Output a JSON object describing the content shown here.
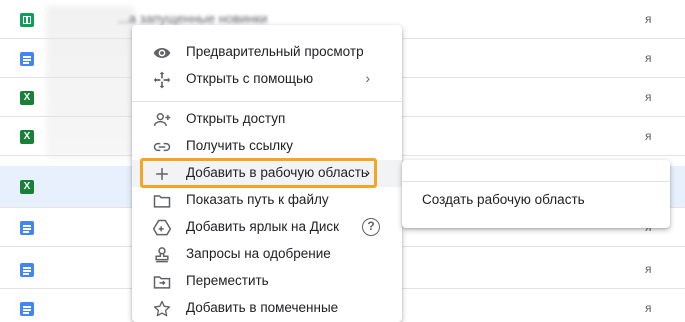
{
  "file_list": {
    "top_row_name": "...а запущенные новинки",
    "rows": [
      {
        "type": "sheet",
        "icon": "google-sheets-icon",
        "owner": "я"
      },
      {
        "type": "doc",
        "icon": "google-docs-icon",
        "owner": "я"
      },
      {
        "type": "excel",
        "icon": "excel-icon",
        "owner": "я"
      },
      {
        "type": "excel",
        "icon": "excel-icon",
        "owner": "я"
      },
      {
        "type": "excel",
        "icon": "excel-icon",
        "owner": "я",
        "selected": true
      },
      {
        "type": "doc",
        "icon": "google-docs-icon",
        "owner": "я"
      },
      {
        "type": "doc",
        "icon": "google-docs-icon",
        "owner": "я"
      },
      {
        "type": "doc",
        "icon": "google-docs-icon",
        "owner": "я"
      }
    ],
    "icon_letters": {
      "excel": "X"
    }
  },
  "context_menu": {
    "items": [
      {
        "label": "Предварительный просмотр",
        "icon": "eye-icon"
      },
      {
        "label": "Открыть с помощью",
        "icon": "move-arrows-icon",
        "submenu": true
      },
      {
        "label": "Открыть доступ",
        "icon": "add-person-icon"
      },
      {
        "label": "Получить ссылку",
        "icon": "link-icon"
      },
      {
        "label": "Добавить в рабочую область",
        "icon": "plus-icon",
        "submenu": true,
        "highlighted": true
      },
      {
        "label": "Показать путь к файлу",
        "icon": "folder-icon"
      },
      {
        "label": "Добавить ярлык на Диск",
        "icon": "drive-shortcut-icon",
        "help": true
      },
      {
        "label": "Запросы на одобрение",
        "icon": "approval-stamp-icon"
      },
      {
        "label": "Переместить",
        "icon": "move-to-folder-icon"
      },
      {
        "label": "Добавить в помеченные",
        "icon": "star-icon"
      }
    ],
    "submenu_arrow": "›",
    "help_glyph": "?"
  },
  "workspace_submenu": {
    "items": [
      {
        "label": "Создать рабочую область"
      }
    ]
  },
  "colors": {
    "highlight_frame": "#f4a623",
    "selected_row": "#e8f0fe",
    "sheets_green": "#0f9d58",
    "docs_blue": "#4285f4"
  }
}
